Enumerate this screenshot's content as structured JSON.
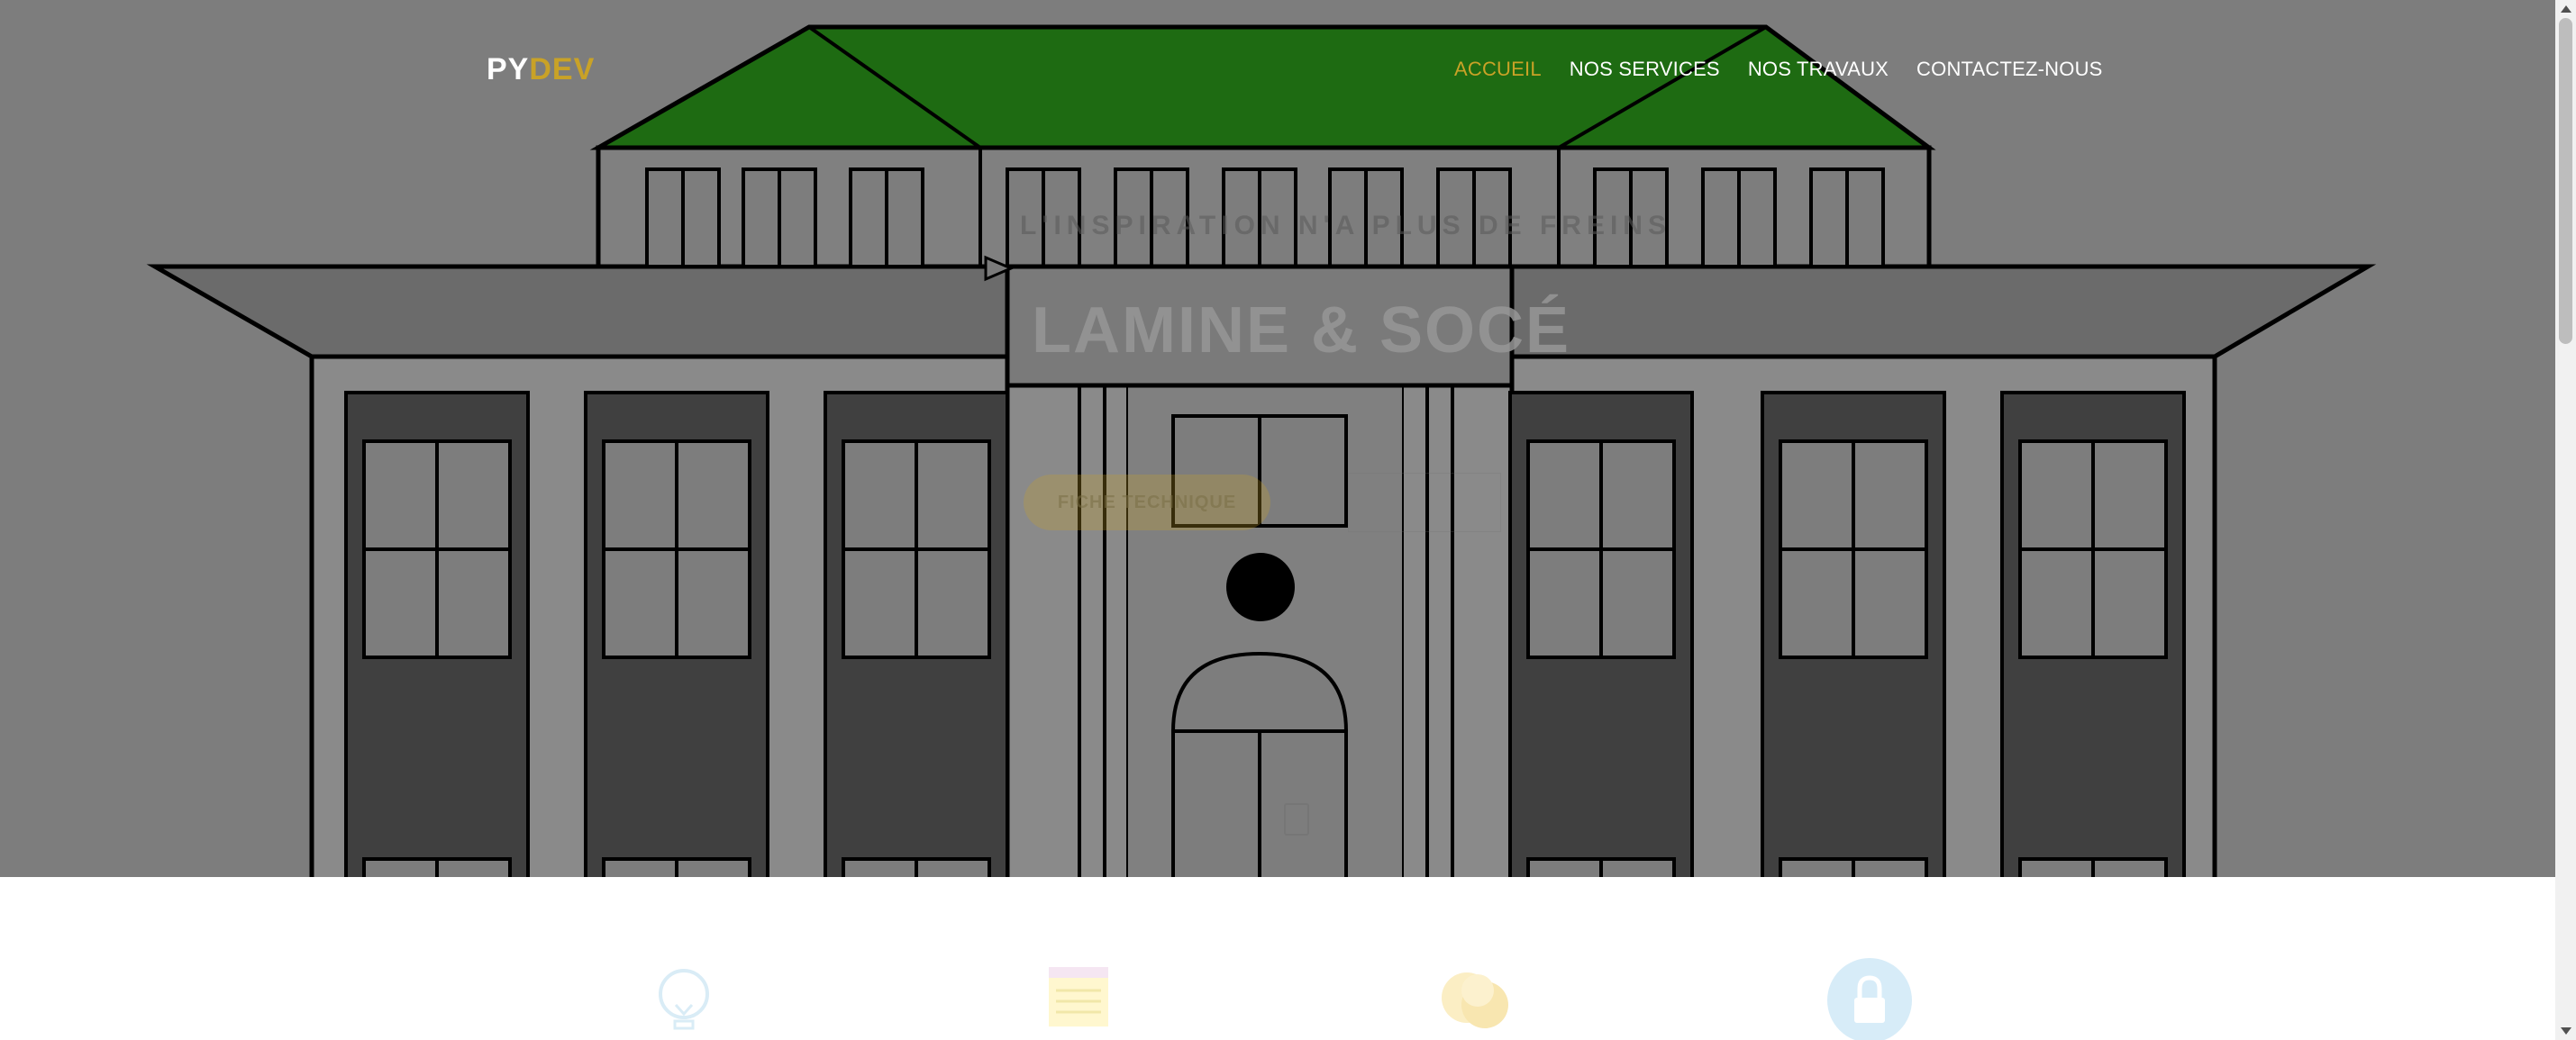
{
  "brand": {
    "part1": "PY",
    "part2": "DEV"
  },
  "nav": {
    "items": [
      {
        "label": "ACCUEIL",
        "active": true
      },
      {
        "label": "NOS SERVICES",
        "active": false
      },
      {
        "label": "NOS TRAVAUX",
        "active": false
      },
      {
        "label": "CONTACTEZ-NOUS",
        "active": false
      }
    ]
  },
  "hero": {
    "tagline": "L'INSPIRATION N'A PLUS DE FREINS",
    "title": "LAMINE & SOCÉ",
    "primary_button": "FICHE TECHNIQUE",
    "secondary_button": ""
  },
  "services": {
    "icons": [
      "lightbulb-icon",
      "note-icon",
      "coins-icon",
      "lock-icon"
    ]
  },
  "colors": {
    "accent": "#c9a227",
    "roof": "#1e6b12",
    "hero_bg": "#7d7d7d",
    "lock_circle": "#d7ecf8"
  }
}
